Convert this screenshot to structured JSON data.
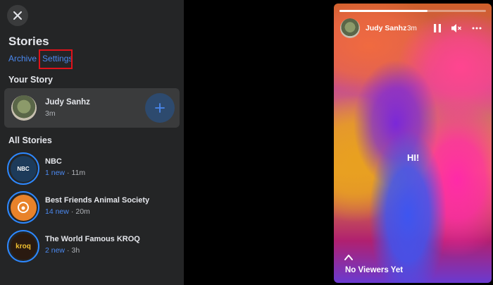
{
  "sidebar": {
    "title": "Stories",
    "archive_label": "Archive",
    "separator": "·",
    "settings_label": "Settings",
    "your_story_label": "Your Story",
    "all_stories_label": "All Stories",
    "your_story": {
      "name": "Judy Sanhz",
      "time": "3m"
    },
    "stories": [
      {
        "name": "NBC",
        "new": "1 new",
        "time": "11m",
        "avatar_text": "NBC"
      },
      {
        "name": "Best Friends Animal Society",
        "new": "14 new",
        "time": "20m",
        "avatar_text": ""
      },
      {
        "name": "The World Famous KROQ",
        "new": "2 new",
        "time": "3h",
        "avatar_text": "kroq"
      }
    ]
  },
  "viewer": {
    "name": "Judy Sanhz",
    "time": "3m",
    "text": "HI!",
    "viewers_label": "No Viewers Yet",
    "progress": 0.6
  },
  "colors": {
    "accent": "#4b89f0",
    "sidebar_bg": "#242526",
    "highlight": "#e0121a"
  }
}
